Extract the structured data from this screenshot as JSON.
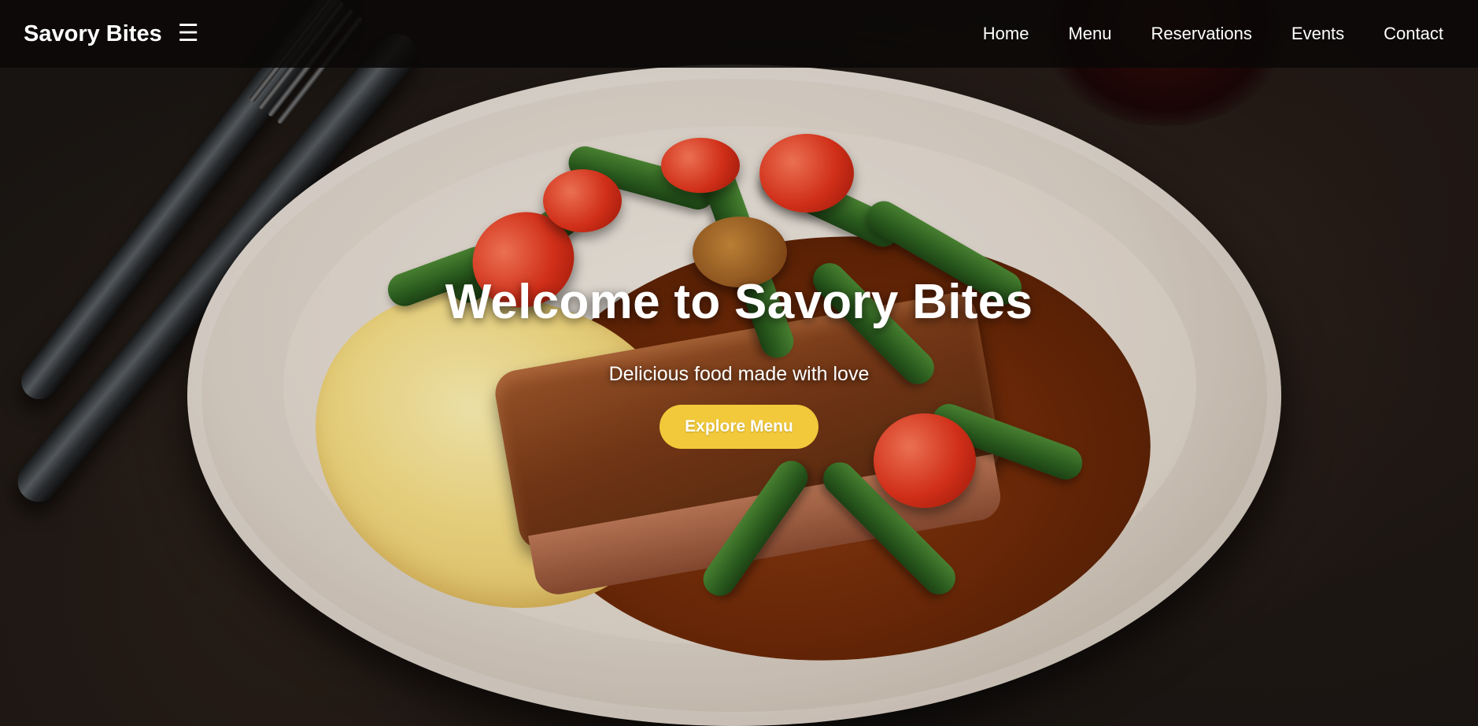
{
  "nav": {
    "brand": "Savory Bites",
    "menu_icon": "hamburger-icon",
    "links": [
      "Home",
      "Menu",
      "Reservations",
      "Events",
      "Contact"
    ]
  },
  "hero": {
    "title": "Welcome to Savory Bites",
    "subtitle": "Delicious food made with love",
    "cta_label": "Explore Menu"
  },
  "colors": {
    "accent": "#f2c93a",
    "navbar": "#0a0807"
  }
}
